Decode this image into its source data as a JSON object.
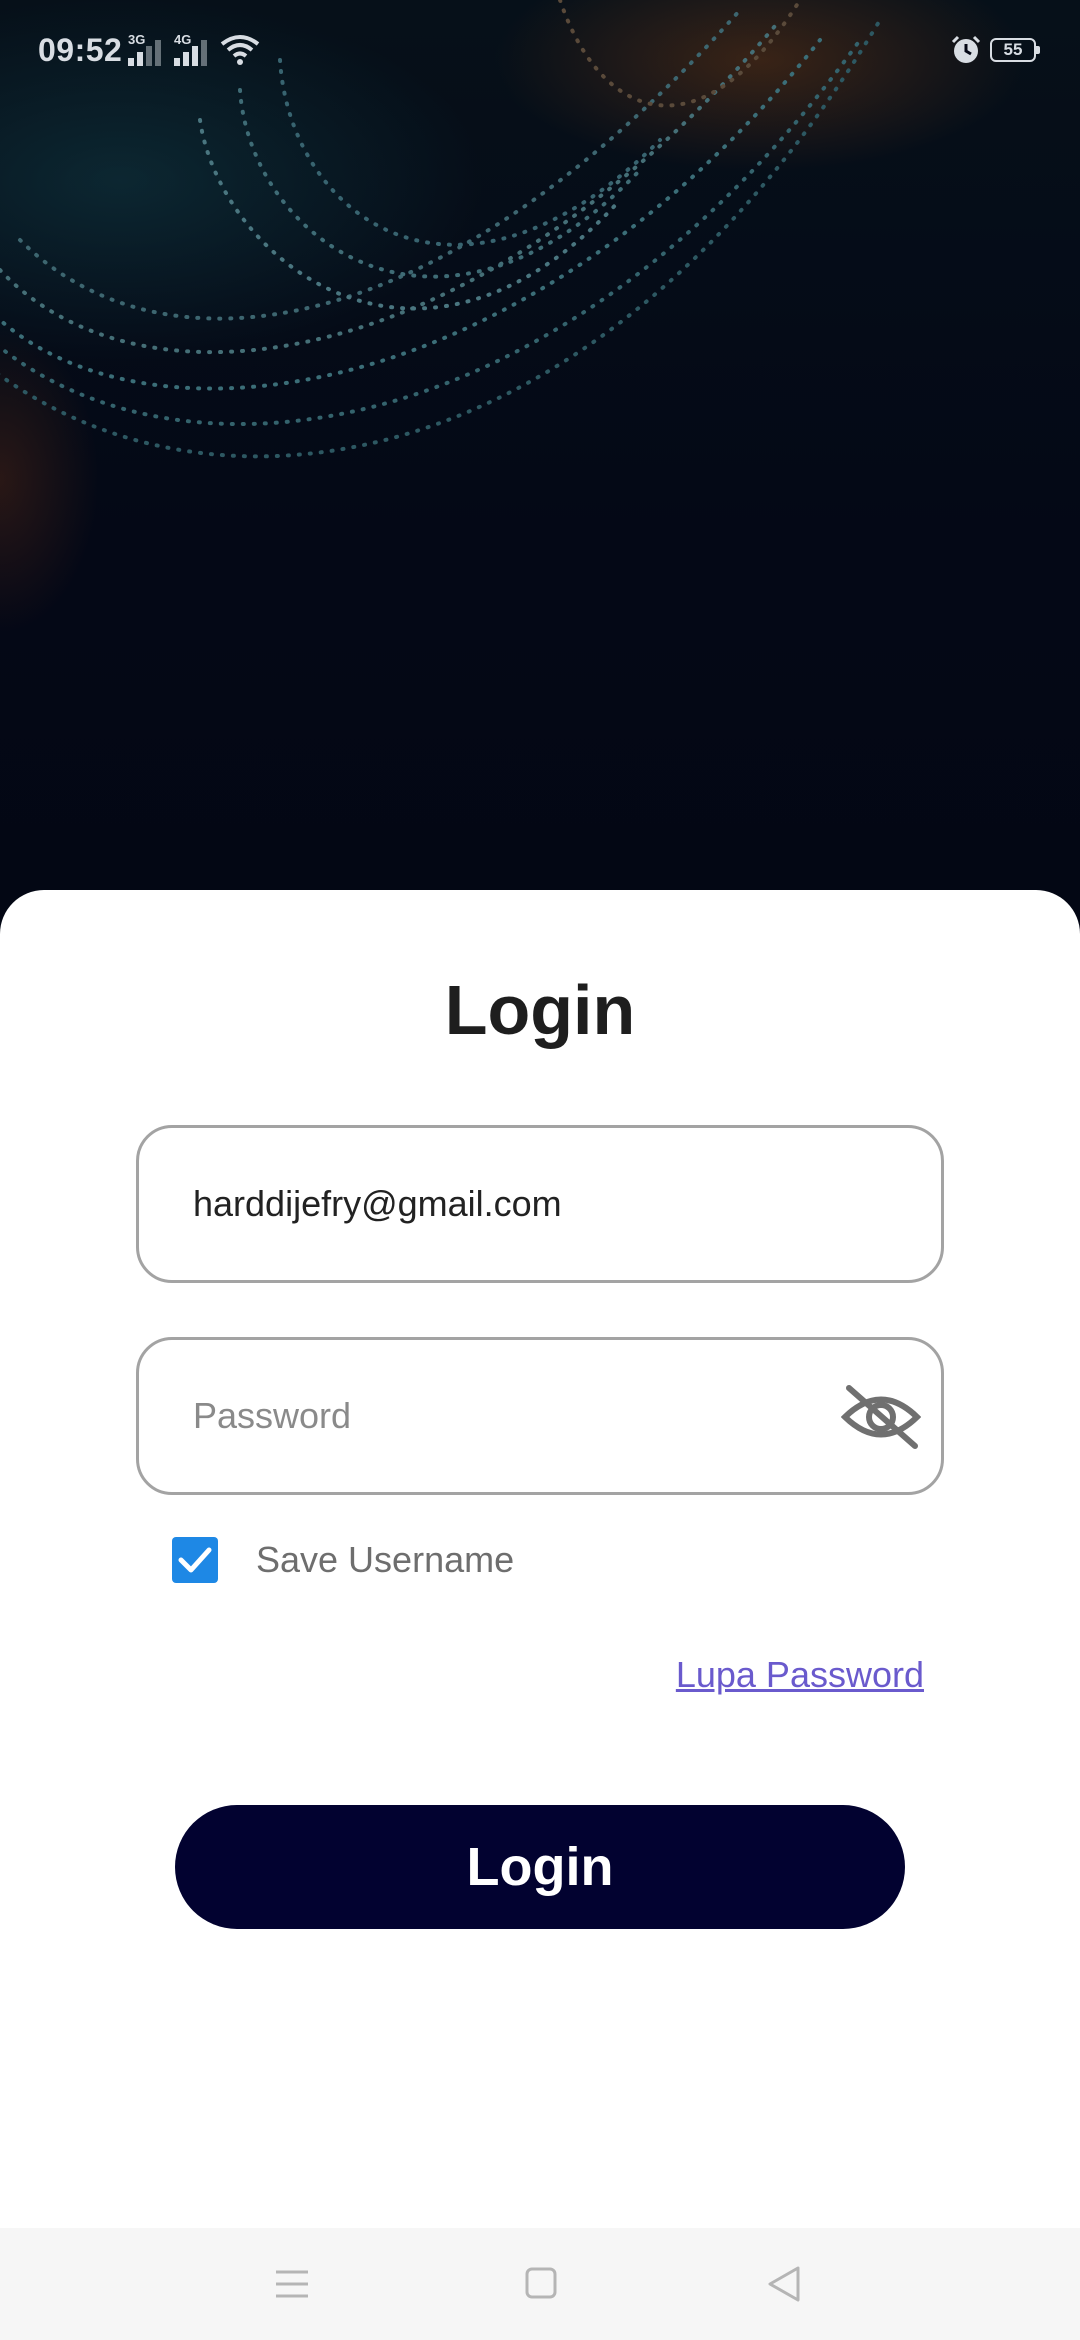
{
  "status_bar": {
    "time": "09:52",
    "signal_1_label": "3G",
    "signal_2_label": "4G",
    "battery": "55",
    "icons": [
      "signal-icon",
      "signal-icon",
      "wifi-icon",
      "alarm-icon",
      "battery-icon"
    ]
  },
  "login": {
    "title": "Login",
    "email_value": "harddijefry@gmail.com",
    "password_placeholder": "Password",
    "save_username_label": "Save Username",
    "save_username_checked": true,
    "forgot_password_label": "Lupa Password",
    "login_button_label": "Login"
  },
  "colors": {
    "accent": "#020230",
    "checkbox": "#1e88e5",
    "link": "#6a5acd",
    "background": "#040816"
  },
  "nav_bar": {
    "icons": [
      "menu-icon",
      "home-icon",
      "back-icon"
    ]
  }
}
